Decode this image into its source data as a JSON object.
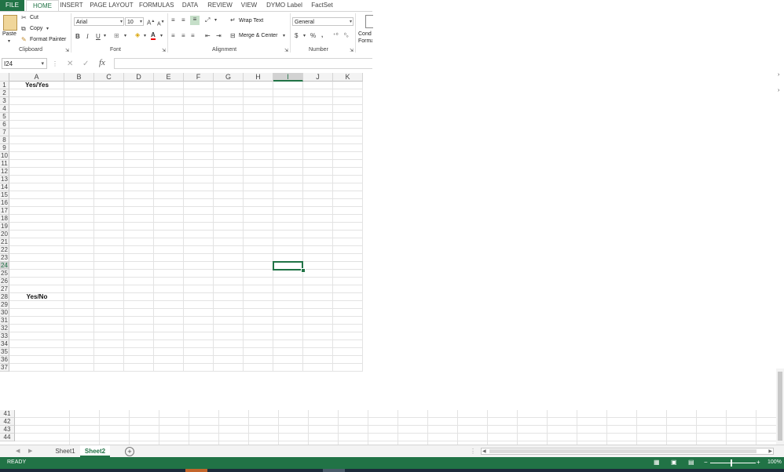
{
  "ribbon": {
    "tabs": [
      "FILE",
      "HOME",
      "INSERT",
      "PAGE LAYOUT",
      "FORMULAS",
      "DATA",
      "REVIEW",
      "VIEW",
      "DYMO Label",
      "FactSet"
    ],
    "clipboard": {
      "paste": "Paste",
      "cut": "Cut",
      "copy": "Copy",
      "format_painter": "Format Painter",
      "label": "Clipboard"
    },
    "font": {
      "name": "Arial",
      "size": "10",
      "bold": "B",
      "italic": "I",
      "underline": "U",
      "label": "Font"
    },
    "alignment": {
      "wrap_text": "Wrap Text",
      "merge_center": "Merge & Center",
      "label": "Alignment"
    },
    "number": {
      "format": "General",
      "currency": "$",
      "percent": "%",
      "comma": ",",
      "label": "Number"
    },
    "styles": {
      "conditional": "Cond Forma"
    }
  },
  "formula_bar": {
    "name_box": "I24",
    "cancel": "✕",
    "enter": "✓",
    "fx": "fx",
    "value": ""
  },
  "grid": {
    "columns": [
      "A",
      "B",
      "C",
      "D",
      "E",
      "F",
      "G",
      "H",
      "I",
      "J",
      "K"
    ],
    "selected_column": "I",
    "rows": [
      "1",
      "2",
      "3",
      "4",
      "5",
      "6",
      "7",
      "8",
      "9",
      "10",
      "11",
      "12",
      "13",
      "14",
      "15",
      "16",
      "17",
      "18",
      "19",
      "20",
      "21",
      "22",
      "23",
      "24",
      "25",
      "26",
      "27",
      "28",
      "29",
      "30",
      "31",
      "32",
      "33",
      "34",
      "35",
      "36",
      "37"
    ],
    "selected_row": "24",
    "cells": {
      "A1": "Yes/Yes",
      "A28": "Yes/No"
    }
  },
  "lower_pane": {
    "rows": [
      "41",
      "42",
      "43",
      "44"
    ]
  },
  "sheets": {
    "tabs": [
      "Sheet1",
      "Sheet2"
    ],
    "active": "Sheet2"
  },
  "status": {
    "ready": "READY",
    "zoom": "100%"
  },
  "colors": {
    "accent": "#217346"
  }
}
